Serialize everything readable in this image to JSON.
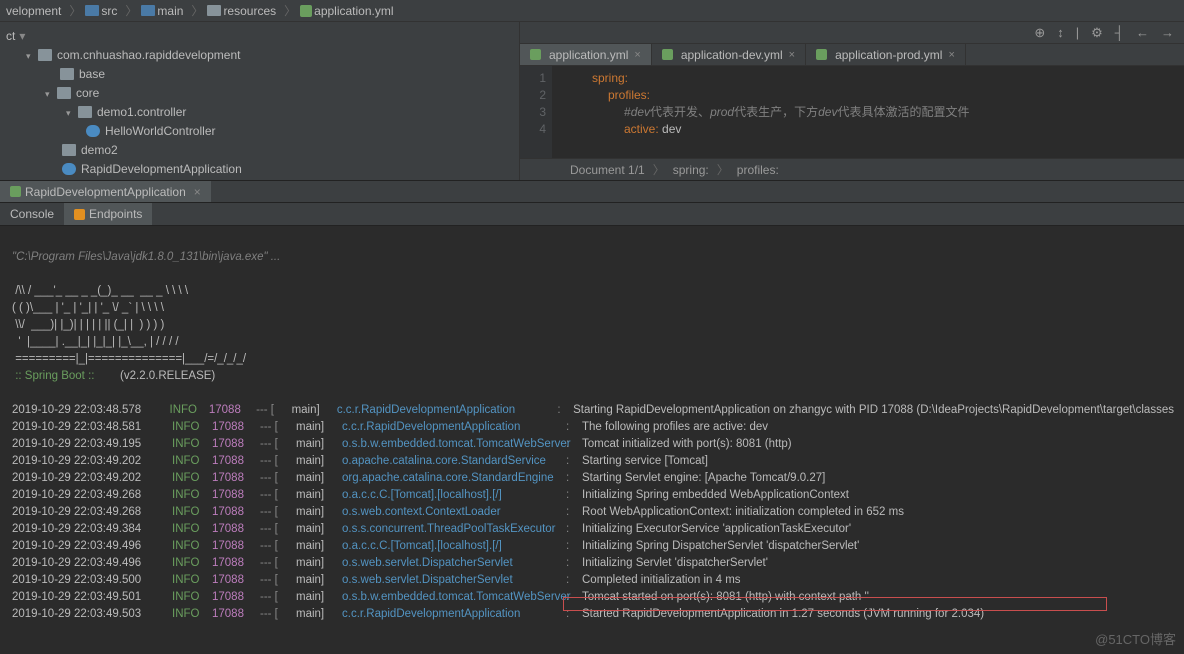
{
  "breadcrumb": [
    "velopment",
    "src",
    "main",
    "resources",
    "application.yml"
  ],
  "ct_label": "ct",
  "tree": {
    "root": "com.cnhuashao.rapiddevelopment",
    "items": [
      {
        "label": "base",
        "indent": 60
      },
      {
        "label": "core",
        "indent": 45,
        "arrow": true
      },
      {
        "label": "demo1.controller",
        "indent": 66,
        "arrow": true
      },
      {
        "label": "HelloWorldController",
        "indent": 86,
        "cls": true
      },
      {
        "label": "demo2",
        "indent": 62
      },
      {
        "label": "RapidDevelopmentApplication",
        "indent": 62,
        "cls": true
      }
    ]
  },
  "toolbar": [
    "⊕",
    "↕",
    "|",
    "⚙",
    "┤",
    "←",
    "→"
  ],
  "editor_tabs": [
    {
      "label": "application.yml",
      "active": true
    },
    {
      "label": "application-dev.yml",
      "active": false
    },
    {
      "label": "application-prod.yml",
      "active": false
    }
  ],
  "code": {
    "l1": "spring:",
    "l2": "profiles:",
    "l3a": "#",
    "l3b": "dev",
    "l3c": "代表开发、",
    "l3d": "prod",
    "l3e": "代表生产，下方",
    "l3f": "dev",
    "l3g": "代表具体激活的配置文件",
    "l4a": "active:",
    "l4b": " dev"
  },
  "code_crumb": [
    "Document 1/1",
    "spring:",
    "profiles:"
  ],
  "run_tab": "RapidDevelopmentApplication",
  "console_tabs": [
    "Console",
    "Endpoints"
  ],
  "cmd": "\"C:\\Program Files\\Java\\jdk1.8.0_131\\bin\\java.exe\" ...",
  "ascii": [
    " /\\\\ / ___'_ __ _ _(_)_ __  __ _ \\ \\ \\ \\",
    "( ( )\\___ | '_ | '_| | '_ \\/ _` | \\ \\ \\ \\",
    " \\\\/  ___)| |_)| | | | | || (_| |  ) ) ) )",
    "  '  |____| .__|_| |_|_| |_\\__, | / / / /",
    " =========|_|==============|___/=/_/_/_/"
  ],
  "sb_label": " :: Spring Boot :: ",
  "sb_ver": "       (v2.2.0.RELEASE)",
  "logs": [
    {
      "ts": "2019-10-29 22:03:48.578",
      "lvl": "INFO",
      "pid": "17088",
      "thr": "main]",
      "src": "c.c.r.RapidDevelopmentApplication",
      "msg": "Starting RapidDevelopmentApplication on zhangyc with PID 17088 (D:\\IdeaProjects\\RapidDevelopment\\target\\classes"
    },
    {
      "ts": "2019-10-29 22:03:48.581",
      "lvl": "INFO",
      "pid": "17088",
      "thr": "main]",
      "src": "c.c.r.RapidDevelopmentApplication",
      "msg": "The following profiles are active: dev"
    },
    {
      "ts": "2019-10-29 22:03:49.195",
      "lvl": "INFO",
      "pid": "17088",
      "thr": "main]",
      "src": "o.s.b.w.embedded.tomcat.TomcatWebServer",
      "msg": "Tomcat initialized with port(s): 8081 (http)"
    },
    {
      "ts": "2019-10-29 22:03:49.202",
      "lvl": "INFO",
      "pid": "17088",
      "thr": "main]",
      "src": "o.apache.catalina.core.StandardService",
      "msg": "Starting service [Tomcat]"
    },
    {
      "ts": "2019-10-29 22:03:49.202",
      "lvl": "INFO",
      "pid": "17088",
      "thr": "main]",
      "src": "org.apache.catalina.core.StandardEngine",
      "msg": "Starting Servlet engine: [Apache Tomcat/9.0.27]"
    },
    {
      "ts": "2019-10-29 22:03:49.268",
      "lvl": "INFO",
      "pid": "17088",
      "thr": "main]",
      "src": "o.a.c.c.C.[Tomcat].[localhost].[/]",
      "msg": "Initializing Spring embedded WebApplicationContext"
    },
    {
      "ts": "2019-10-29 22:03:49.268",
      "lvl": "INFO",
      "pid": "17088",
      "thr": "main]",
      "src": "o.s.web.context.ContextLoader",
      "msg": "Root WebApplicationContext: initialization completed in 652 ms"
    },
    {
      "ts": "2019-10-29 22:03:49.384",
      "lvl": "INFO",
      "pid": "17088",
      "thr": "main]",
      "src": "o.s.s.concurrent.ThreadPoolTaskExecutor",
      "msg": "Initializing ExecutorService 'applicationTaskExecutor'"
    },
    {
      "ts": "2019-10-29 22:03:49.496",
      "lvl": "INFO",
      "pid": "17088",
      "thr": "main]",
      "src": "o.a.c.c.C.[Tomcat].[localhost].[/]",
      "msg": "Initializing Spring DispatcherServlet 'dispatcherServlet'"
    },
    {
      "ts": "2019-10-29 22:03:49.496",
      "lvl": "INFO",
      "pid": "17088",
      "thr": "main]",
      "src": "o.s.web.servlet.DispatcherServlet",
      "msg": "Initializing Servlet 'dispatcherServlet'"
    },
    {
      "ts": "2019-10-29 22:03:49.500",
      "lvl": "INFO",
      "pid": "17088",
      "thr": "main]",
      "src": "o.s.web.servlet.DispatcherServlet",
      "msg": "Completed initialization in 4 ms"
    },
    {
      "ts": "2019-10-29 22:03:49.501",
      "lvl": "INFO",
      "pid": "17088",
      "thr": "main]",
      "src": "o.s.b.w.embedded.tomcat.TomcatWebServer",
      "msg": "Tomcat started on port(s): 8081 (http) with context path ''"
    },
    {
      "ts": "2019-10-29 22:03:49.503",
      "lvl": "INFO",
      "pid": "17088",
      "thr": "main]",
      "src": "c.c.r.RapidDevelopmentApplication",
      "msg": "Started RapidDevelopmentApplication in 1.27 seconds (JVM running for 2.034)"
    }
  ],
  "watermark": "@51CTO博客"
}
